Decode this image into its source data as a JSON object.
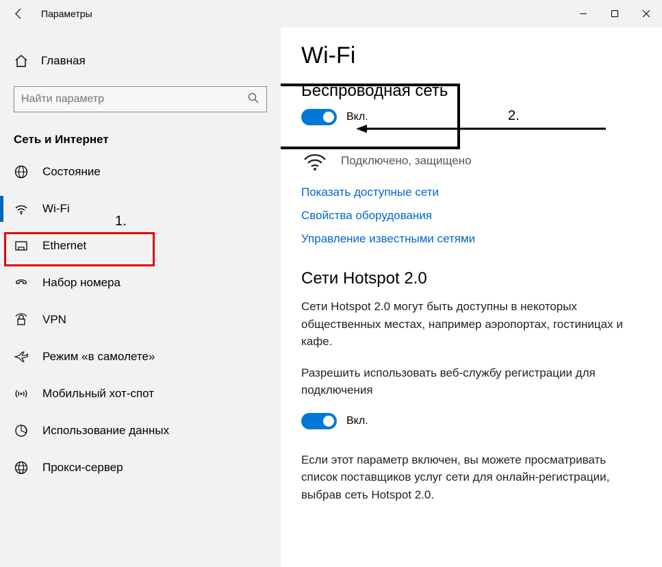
{
  "titlebar": {
    "title": "Параметры"
  },
  "sidebar": {
    "home_label": "Главная",
    "search_placeholder": "Найти параметр",
    "section_head": "Сеть и Интернет",
    "items": [
      {
        "label": "Состояние"
      },
      {
        "label": "Wi-Fi"
      },
      {
        "label": "Ethernet"
      },
      {
        "label": "Набор номера"
      },
      {
        "label": "VPN"
      },
      {
        "label": "Режим «в самолете»"
      },
      {
        "label": "Мобильный хот-спот"
      },
      {
        "label": "Использование данных"
      },
      {
        "label": "Прокси-сервер"
      }
    ]
  },
  "main": {
    "page_title": "Wi-Fi",
    "wireless_head": "Беспроводная сеть",
    "wireless_toggle_label": "Вкл.",
    "status_text": "Подключено, защищено",
    "link_show_networks": "Показать доступные сети",
    "link_hardware_props": "Свойства оборудования",
    "link_known_networks": "Управление известными сетями",
    "hotspot_head": "Сети Hotspot 2.0",
    "hotspot_para1": "Сети Hotspot 2.0 могут быть доступны в некоторых общественных местах, например аэропортах, гостиницах и кафе.",
    "hotspot_para2": "Разрешить использовать веб-службу регистрации для подключения",
    "hotspot_toggle_label": "Вкл.",
    "hotspot_para3": "Если этот параметр включен, вы можете просматривать список поставщиков услуг сети для онлайн-регистрации, выбрав сеть Hotspot 2.0."
  },
  "annotations": {
    "label1": "1.",
    "label2": "2."
  }
}
